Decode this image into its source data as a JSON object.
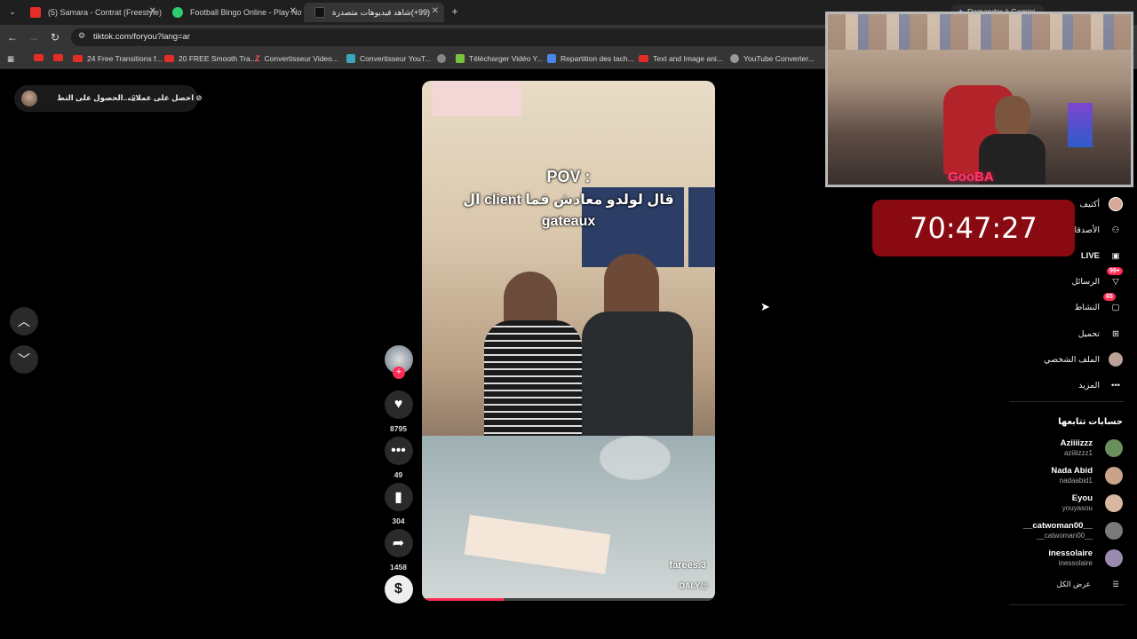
{
  "browser": {
    "tabs": [
      {
        "title": "(5) Samara - Contrat (Freestyle)",
        "favicon_color": "#e52d27"
      },
      {
        "title": "Football Bingo Online - Play Now",
        "favicon_color": "#2ecc71"
      },
      {
        "title": "(99+)شاهد فيديوهات متصدرة",
        "favicon_color": "#111111"
      }
    ],
    "url": "tiktok.com/foryou?lang=ar",
    "gemini_button": "Demander à Gemini",
    "bookmarks": [
      "",
      "",
      "24 Free Transitions f...",
      "20 FREE Smooth Tra...",
      "Convertisseur Video...",
      "Convertisseur YouT...",
      "",
      "Télécharger Vidéo Y...",
      "Repartition des tach...",
      "Text and Image ani...",
      "YouTube Converter..."
    ]
  },
  "tiktok": {
    "top_pill": {
      "item1": "احصل على عملات",
      "item2": "الحصول على التط..."
    },
    "video": {
      "caption_line1": "POV :",
      "caption_line2": "ال client قال لولدو معادش فما",
      "caption_line3": "gateaux",
      "author_watermark": "farees.3",
      "handle_watermark": "DALY@",
      "progress": 0.28
    },
    "actions": {
      "likes": "8795",
      "comments": "49",
      "saves": "304",
      "shares": "1458"
    },
    "nav": [
      {
        "label": "أكتيف",
        "icon": "avatar-icon"
      },
      {
        "label": "الأصدقاء",
        "icon": "friends-icon"
      },
      {
        "label": "LIVE",
        "icon": "live-icon"
      },
      {
        "label": "الرسائل",
        "icon": "inbox-icon",
        "badge": "99+"
      },
      {
        "label": "النشاط",
        "icon": "activity-icon",
        "badge": "65"
      },
      {
        "label": "تحميل",
        "icon": "upload-icon"
      },
      {
        "label": "الملف الشخصي",
        "icon": "profile-icon"
      },
      {
        "label": "المزيد",
        "icon": "more-icon"
      }
    ],
    "following_title": "حسابات تتابعها",
    "following": [
      {
        "name": "Aziiiizzz",
        "handle": "aziiiizzz1",
        "color": "#6b8f5a"
      },
      {
        "name": "Nada Abid",
        "handle": "nadaabid1",
        "color": "#c9a38a"
      },
      {
        "name": "Eyou",
        "handle": "youyasou",
        "color": "#d8b8a0"
      },
      {
        "name": "__catwoman00__",
        "handle": "__catwoman00__",
        "color": "#7a7a7a"
      },
      {
        "name": "inessolaire",
        "handle": "inessolaire",
        "color": "#9a8ab0"
      }
    ],
    "see_all": "عرض الكل"
  },
  "overlay": {
    "timer": "70:47:27",
    "logo_text": "GooBA"
  }
}
